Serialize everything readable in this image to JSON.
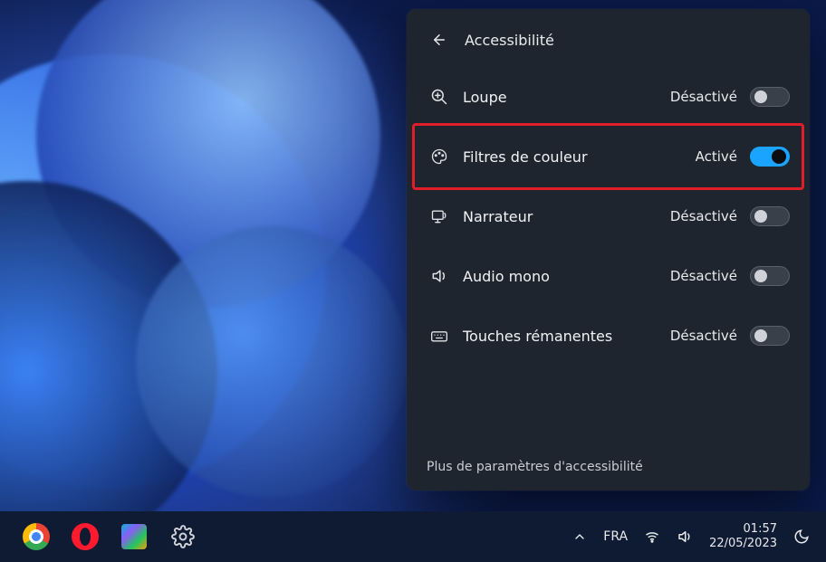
{
  "panel": {
    "title": "Accessibilité",
    "rows": [
      {
        "label": "Loupe",
        "status": "Désactivé",
        "on": false
      },
      {
        "label": "Filtres de couleur",
        "status": "Activé",
        "on": true,
        "highlight": true
      },
      {
        "label": "Narrateur",
        "status": "Désactivé",
        "on": false
      },
      {
        "label": "Audio mono",
        "status": "Désactivé",
        "on": false
      },
      {
        "label": "Touches rémanentes",
        "status": "Désactivé",
        "on": false
      }
    ],
    "footer_link": "Plus de paramètres d'accessibilité"
  },
  "taskbar": {
    "lang": "FRA",
    "time": "01:57",
    "date": "22/05/2023"
  }
}
